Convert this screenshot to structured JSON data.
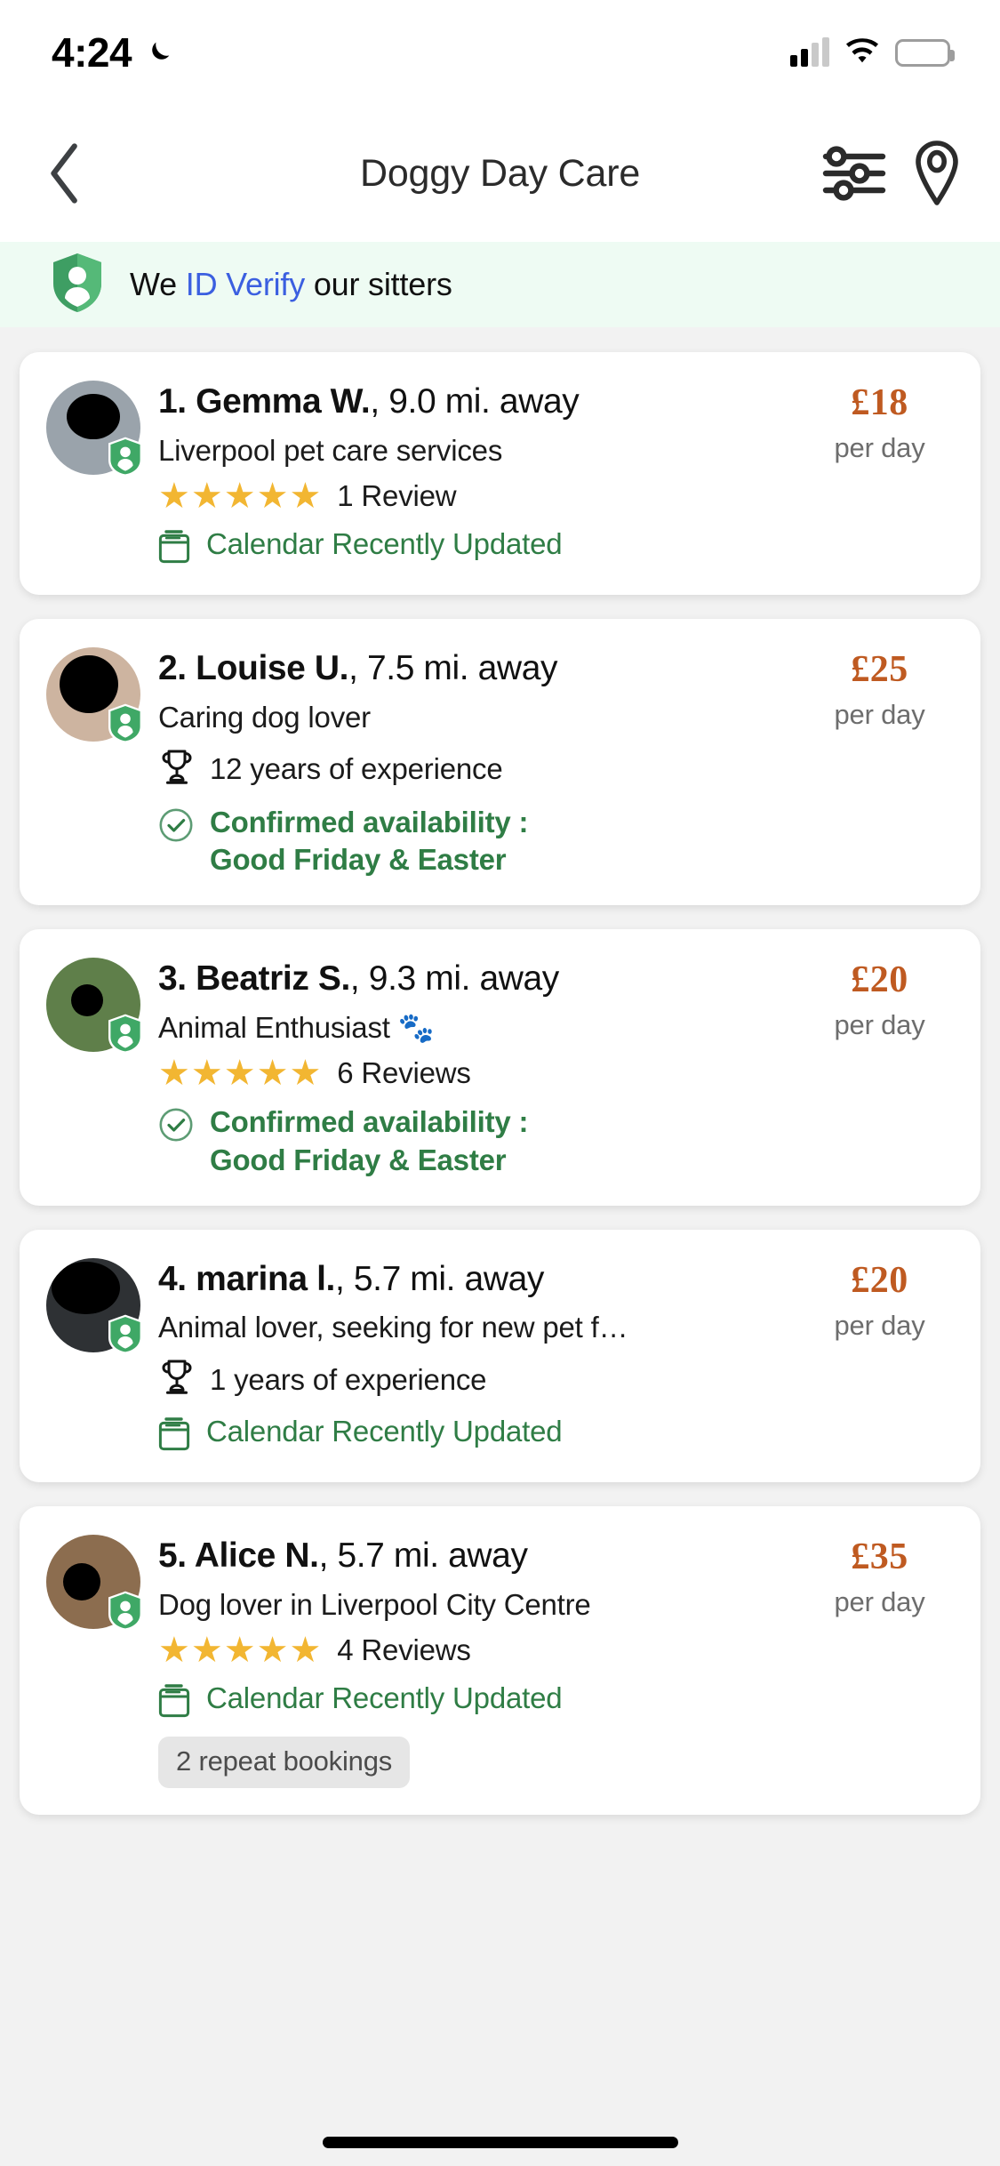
{
  "status_bar": {
    "time": "4:24",
    "moon_icon": "crescent-moon-icon",
    "signal_icon": "cellular-signal-icon",
    "wifi_icon": "wifi-icon",
    "battery_icon": "battery-full-icon"
  },
  "nav": {
    "back_icon": "chevron-left-icon",
    "title": "Doggy Day Care",
    "filter_icon": "filter-sliders-icon",
    "map_icon": "map-pin-icon"
  },
  "verify_banner": {
    "shield_icon": "shield-person-verified-icon",
    "prefix": "We ",
    "link": "ID Verify",
    "suffix": " our sitters",
    "link_color": "#3b5fe0",
    "background": "#eefbf3"
  },
  "labels": {
    "per_day": "per day",
    "star_glyph": "★",
    "paw_glyph": "🐾"
  },
  "colors": {
    "price": "#bf5a21",
    "green": "#2f7d45",
    "star": "#f2b632",
    "page_bg": "#f2f2f2"
  },
  "sitters": [
    {
      "rank": "1. ",
      "name": "Gemma W.",
      "distance": ", 9.0 mi. away",
      "tagline": "Liverpool pet care services",
      "rating": 5,
      "reviews": "1 Review",
      "badge_icon": "calendar-icon",
      "badge_text": "Calendar Recently Updated",
      "badge_style": "green",
      "price": "£18",
      "verified": true
    },
    {
      "rank": "2. ",
      "name": "Louise U.",
      "distance": ", 7.5 mi. away",
      "tagline": "Caring dog lover",
      "experience_icon": "trophy-icon",
      "experience": "12 years of experience",
      "badge_icon": "check-circle-icon",
      "badge_text": "Confirmed availability :\nGood Friday & Easter",
      "badge_style": "green-bold",
      "price": "£25",
      "verified": true
    },
    {
      "rank": "3. ",
      "name": "Beatriz S.",
      "distance": ", 9.3 mi. away",
      "tagline": "Animal Enthusiast 🐾",
      "rating": 5,
      "reviews": "6 Reviews",
      "badge_icon": "check-circle-icon",
      "badge_text": "Confirmed availability :\nGood Friday & Easter",
      "badge_style": "green-bold",
      "price": "£20",
      "verified": true
    },
    {
      "rank": "4. ",
      "name": "marina l.",
      "distance": ", 5.7 mi. away",
      "tagline": "Animal lover, seeking for new pet f…",
      "experience_icon": "trophy-icon",
      "experience": "1 years of experience",
      "badge_icon": "calendar-icon",
      "badge_text": "Calendar Recently Updated",
      "badge_style": "green",
      "price": "£20",
      "verified": true
    },
    {
      "rank": "5. ",
      "name": "Alice N.",
      "distance": ", 5.7 mi. away",
      "tagline": "Dog lover in Liverpool City Centre",
      "rating": 5,
      "reviews": "4 Reviews",
      "badge_icon": "calendar-icon",
      "badge_text": "Calendar Recently Updated",
      "badge_style": "green",
      "repeat_bookings": "2 repeat bookings",
      "price": "£35",
      "verified": true
    }
  ]
}
